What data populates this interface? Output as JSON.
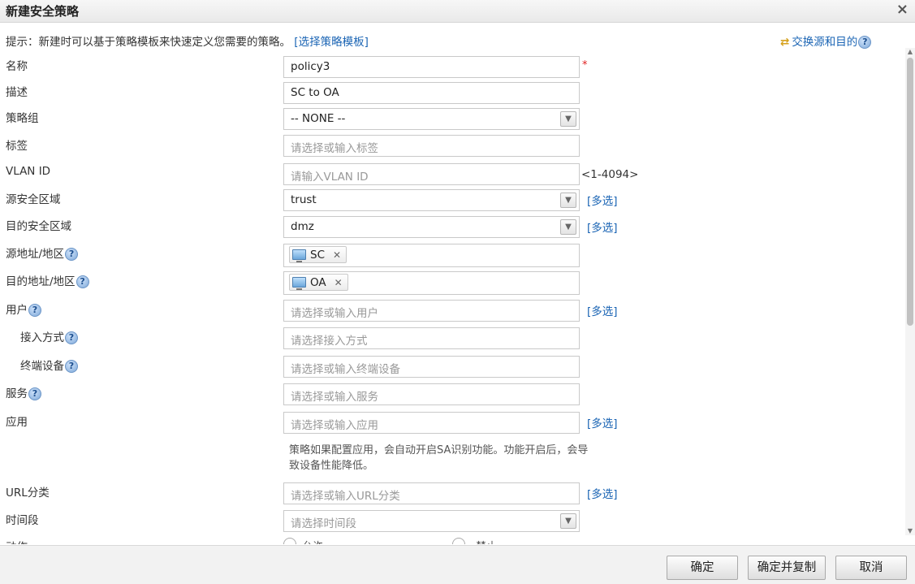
{
  "dialog": {
    "title": "新建安全策略",
    "close": "×"
  },
  "hint": {
    "text": "提示：新建时可以基于策略模板来快速定义您需要的策略。",
    "link": "[选择策略模板]"
  },
  "swap_link": "交换源和目的",
  "help_glyph": "?",
  "multi_label": "[多选]",
  "fields": {
    "name": {
      "label": "名称",
      "value": "policy3",
      "required_mark": "*"
    },
    "description": {
      "label": "描述",
      "value": "SC to OA"
    },
    "policy_group": {
      "label": "策略组",
      "value": "-- NONE --"
    },
    "tag": {
      "label": "标签",
      "placeholder": "请选择或输入标签"
    },
    "vlan_id": {
      "label": "VLAN ID",
      "placeholder": "请输入VLAN ID",
      "range": "<1-4094>"
    },
    "source_zone": {
      "label": "源安全区域",
      "value": "trust"
    },
    "dest_zone": {
      "label": "目的安全区域",
      "value": "dmz"
    },
    "source_address": {
      "label": "源地址/地区",
      "tag": "SC"
    },
    "dest_address": {
      "label": "目的地址/地区",
      "tag": "OA"
    },
    "user": {
      "label": "用户",
      "placeholder": "请选择或输入用户"
    },
    "access_mode": {
      "label": "接入方式",
      "placeholder": "请选择接入方式"
    },
    "terminal_device": {
      "label": "终端设备",
      "placeholder": "请选择或输入终端设备"
    },
    "service": {
      "label": "服务",
      "placeholder": "请选择或输入服务"
    },
    "application": {
      "label": "应用",
      "placeholder": "请选择或输入应用",
      "note": "策略如果配置应用，会自动开启SA识别功能。功能开启后，会导致设备性能降低。"
    },
    "url_category": {
      "label": "URL分类",
      "placeholder": "请选择或输入URL分类"
    },
    "time_range": {
      "label": "时间段",
      "placeholder": "请选择时间段"
    },
    "action": {
      "label": "动作",
      "options": [
        "允许",
        "禁止"
      ]
    }
  },
  "buttons": {
    "ok": "确定",
    "ok_copy": "确定并复制",
    "cancel": "取消"
  }
}
